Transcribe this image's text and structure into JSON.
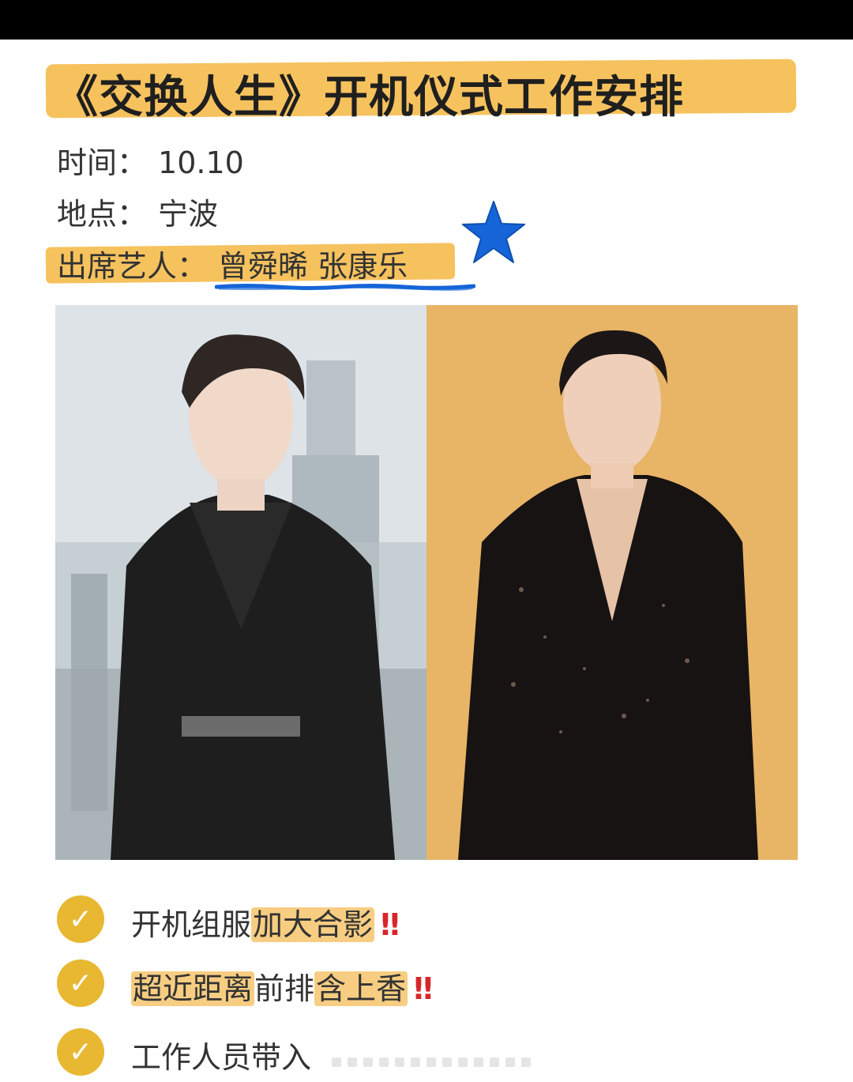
{
  "title": "《交换人生》开机仪式工作安排",
  "info": {
    "time_label": "时间：",
    "time_value": "10.10",
    "place_label": "地点：",
    "place_value": "宁波",
    "artists_label": "出席艺人：",
    "artists_value": "曾舜晞 张康乐"
  },
  "photos": {
    "left_alt": "actor-portrait-left",
    "right_alt": "actor-portrait-right"
  },
  "checklist": [
    {
      "plain_a": "开机组服",
      "highlight_a": "加大合影",
      "plain_b": "",
      "highlight_b": "",
      "mark": "‼"
    },
    {
      "plain_a": "",
      "highlight_a": "超近距离",
      "plain_b": "前排",
      "highlight_b": "含上香",
      "mark": "‼"
    },
    {
      "plain_a": "工作人员带入",
      "highlight_a": "",
      "plain_b": "",
      "highlight_b": "",
      "mark": ""
    }
  ],
  "colors": {
    "highlight": "#f6c25e",
    "check": "#e8b832",
    "star": "#1565d8",
    "alert": "#d7262a"
  },
  "icons": [
    "check-icon",
    "star-icon"
  ]
}
